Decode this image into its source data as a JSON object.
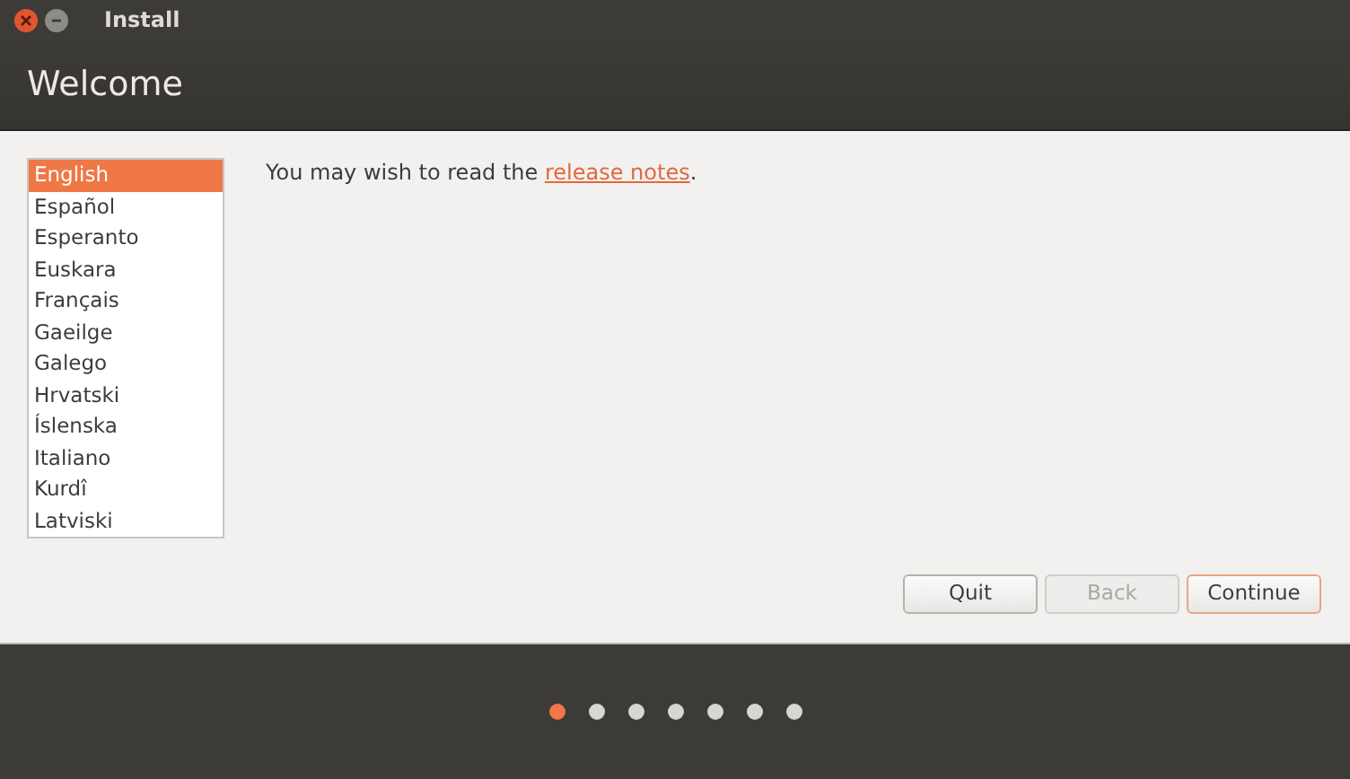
{
  "window": {
    "title": "Install"
  },
  "header": {
    "title": "Welcome"
  },
  "languages": [
    {
      "label": "English",
      "selected": true
    },
    {
      "label": "Español",
      "selected": false
    },
    {
      "label": "Esperanto",
      "selected": false
    },
    {
      "label": "Euskara",
      "selected": false
    },
    {
      "label": "Français",
      "selected": false
    },
    {
      "label": "Gaeilge",
      "selected": false
    },
    {
      "label": "Galego",
      "selected": false
    },
    {
      "label": "Hrvatski",
      "selected": false
    },
    {
      "label": "Íslenska",
      "selected": false
    },
    {
      "label": "Italiano",
      "selected": false
    },
    {
      "label": "Kurdî",
      "selected": false
    },
    {
      "label": "Latviski",
      "selected": false
    }
  ],
  "notes": {
    "before": "You may wish to read the ",
    "link": "release notes",
    "after": "."
  },
  "buttons": [
    {
      "label": "Quit",
      "disabled": false,
      "default": false
    },
    {
      "label": "Back",
      "disabled": true,
      "default": false
    },
    {
      "label": "Continue",
      "disabled": false,
      "default": true
    }
  ],
  "steps": [
    {
      "selected": true
    },
    {
      "selected": false
    },
    {
      "selected": false
    },
    {
      "selected": false
    },
    {
      "selected": false
    },
    {
      "selected": false
    },
    {
      "selected": false
    }
  ]
}
